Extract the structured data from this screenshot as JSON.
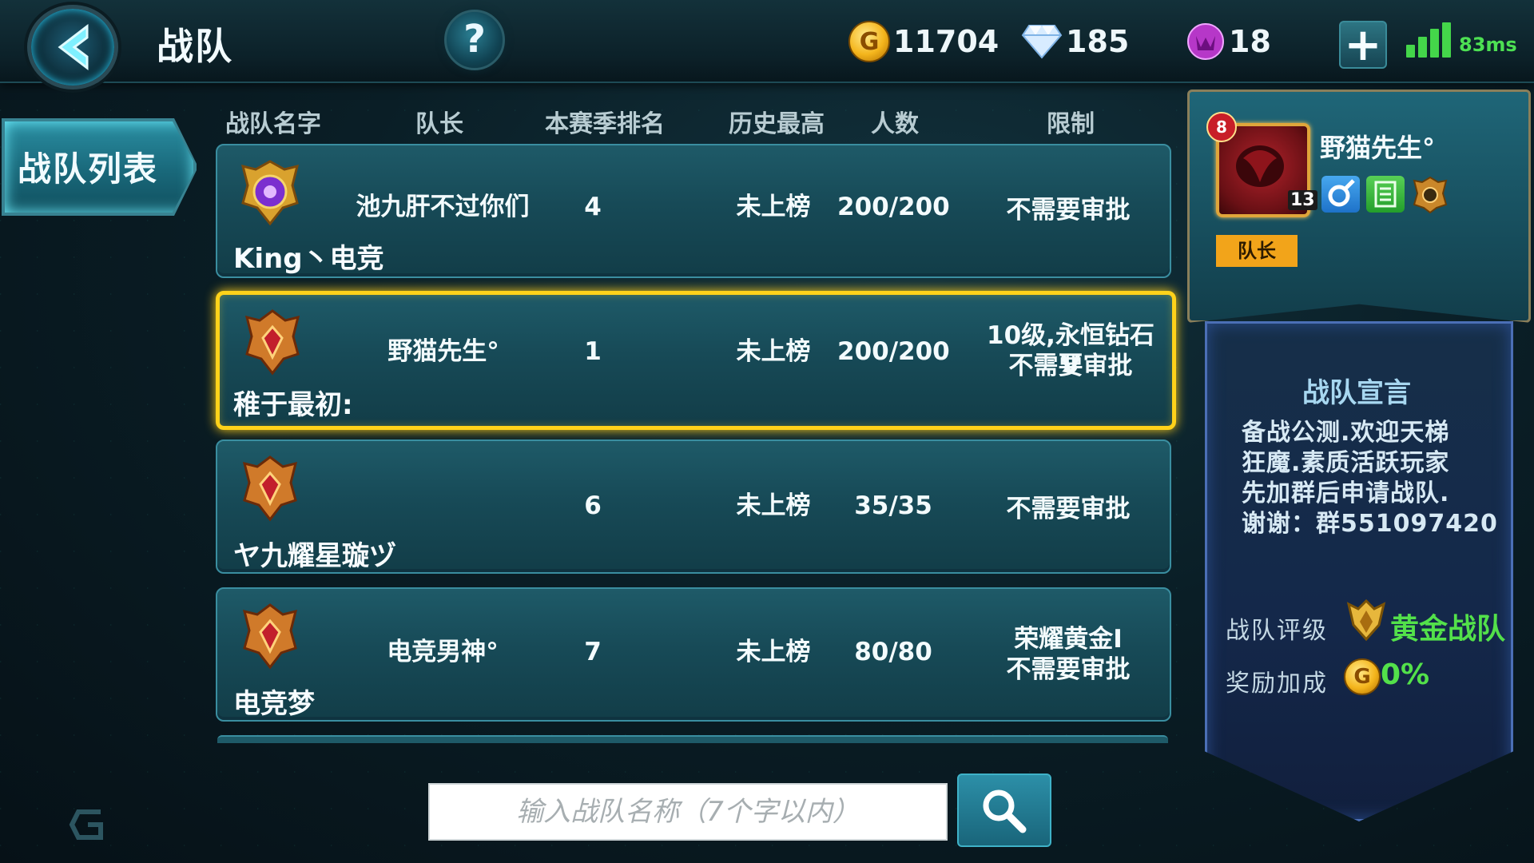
{
  "header": {
    "title": "战队",
    "help_symbol": "?",
    "gold": "11704",
    "diamonds": "185",
    "gems": "18",
    "add_symbol": "+",
    "ping": "83ms",
    "gold_symbol": "G"
  },
  "sidebar": {
    "tab_label": "战队列表"
  },
  "table": {
    "columns": [
      "战队名字",
      "队长",
      "本赛季排名",
      "历史最高",
      "人数",
      "限制"
    ],
    "rows": [
      {
        "team_name": "King丶电竞",
        "captain": "池九肝不过你们",
        "season_rank": "4",
        "history_best": "未上榜",
        "members": "200/200",
        "limit_line1": "不需要审批",
        "limit_line2": ""
      },
      {
        "team_name": "稚于最初:",
        "captain": "野猫先生°",
        "season_rank": "1",
        "history_best": "未上榜",
        "members": "200/200",
        "limit_line1": "10级,永恒钻石V",
        "limit_line2": "不需要审批"
      },
      {
        "team_name": "ヤ九耀星璇ヅ",
        "captain": "",
        "season_rank": "6",
        "history_best": "未上榜",
        "members": "35/35",
        "limit_line1": "不需要审批",
        "limit_line2": ""
      },
      {
        "team_name": "电竞梦",
        "captain": "电竞男神°",
        "season_rank": "7",
        "history_best": "未上榜",
        "members": "80/80",
        "limit_line1": "荣耀黄金I",
        "limit_line2": "不需要审批"
      }
    ]
  },
  "search": {
    "placeholder": "输入战队名称（7个字以内）"
  },
  "detail": {
    "leader_name": "野猫先生°",
    "avatar_level": "8",
    "avatar_rank": "13",
    "role": "队长",
    "manifesto_title": "战队宣言",
    "manifesto_lines": [
      "备战公测.欢迎天梯",
      "狂魔.素质活跃玩家",
      "先加群后申请战队.",
      "谢谢：群551097420"
    ],
    "rating_label": "战队评级",
    "rating_value": "黄金战队",
    "bonus_label": "奖励加成",
    "bonus_value": "0%"
  },
  "colors": {
    "selection": "#ffd21a",
    "accent_green": "#53e14a",
    "role_badge": "#f2a41a"
  }
}
